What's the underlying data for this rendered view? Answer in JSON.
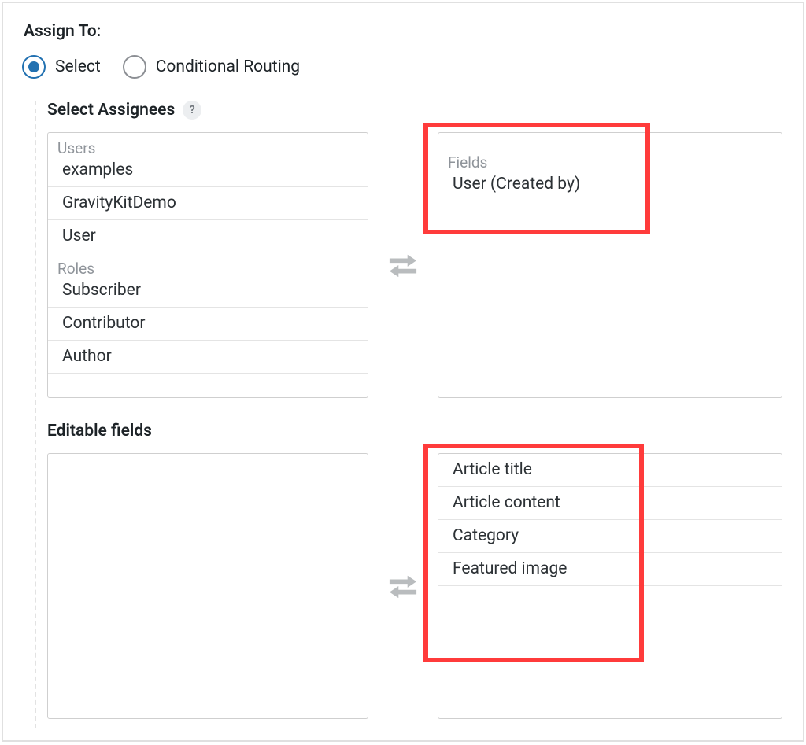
{
  "assign_to_label": "Assign To:",
  "radio": {
    "select": "Select",
    "conditional": "Conditional Routing"
  },
  "assignees": {
    "heading": "Select Assignees",
    "help": "?",
    "left": {
      "group_users": "Users",
      "users": [
        "examples",
        "GravityKitDemo",
        "User"
      ],
      "group_roles": "Roles",
      "roles": [
        "Subscriber",
        "Contributor",
        "Author"
      ]
    },
    "right": {
      "group_fields": "Fields",
      "fields": [
        "User (Created by)"
      ]
    }
  },
  "editable": {
    "heading": "Editable fields",
    "right_items": [
      "Article title",
      "Article content",
      "Category",
      "Featured image"
    ]
  },
  "colors": {
    "highlight": "#ff3b3b",
    "accent": "#2271b1"
  }
}
